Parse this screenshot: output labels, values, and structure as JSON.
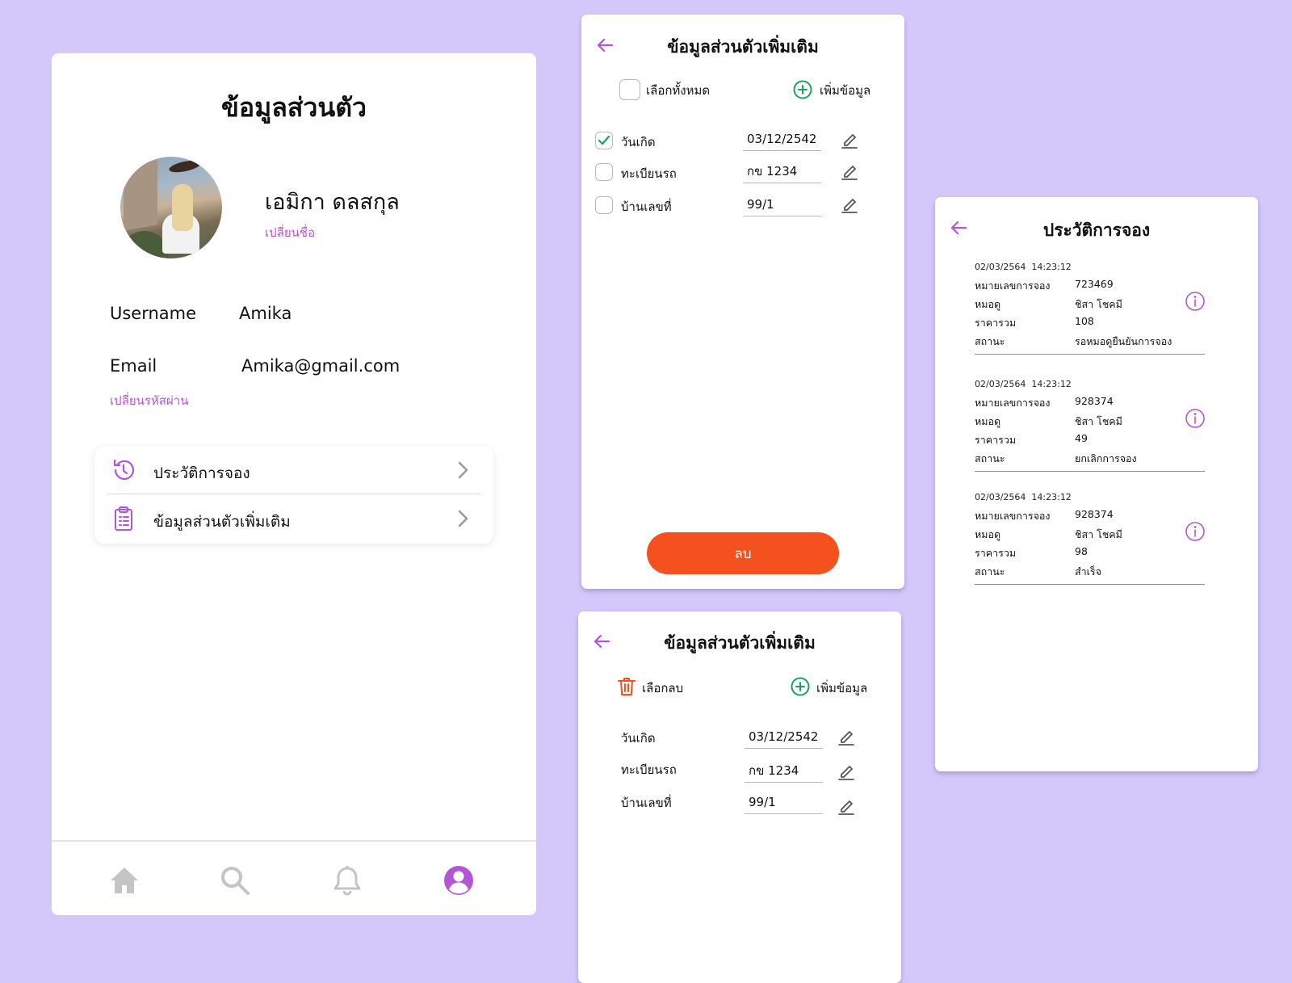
{
  "profile": {
    "title": "ข้อมูลส่วนตัว",
    "name": "เอมิกา ดลสกุล",
    "change_name": "เปลี่ยนชื่อ",
    "username_label": "Username",
    "username_value": "Amika",
    "email_label": "Email",
    "email_value": "Amika@gmail.com",
    "change_password": "เปลี่ยนรหัสผ่าน",
    "menu": [
      {
        "label": "ประวัติการจอง",
        "icon": "history-icon"
      },
      {
        "label": "ข้อมูลส่วนตัวเพิ่มเติม",
        "icon": "clipboard-icon"
      }
    ],
    "nav": [
      {
        "icon": "home-icon",
        "active": false
      },
      {
        "icon": "search-icon",
        "active": false
      },
      {
        "icon": "bell-icon",
        "active": false
      },
      {
        "icon": "profile-icon",
        "active": true
      }
    ]
  },
  "extra_select": {
    "title": "ข้อมูลส่วนตัวเพิ่มเติม",
    "select_all": "เลือกทั้งหมด",
    "add": "เพิ่มข้อมูล",
    "rows": [
      {
        "label": "วันเกิด",
        "value": "03/12/2542",
        "checked": true
      },
      {
        "label": "ทะเบียนรถ",
        "value": "กข 1234",
        "checked": false
      },
      {
        "label": "บ้านเลขที่",
        "value": "99/1",
        "checked": false
      }
    ],
    "delete_button": "ลบ"
  },
  "extra_view": {
    "title": "ข้อมูลส่วนตัวเพิ่มเติม",
    "select_delete": "เลือกลบ",
    "add": "เพิ่มข้อมูล",
    "rows": [
      {
        "label": "วันเกิด",
        "value": "03/12/2542"
      },
      {
        "label": "ทะเบียนรถ",
        "value": "กข 1234"
      },
      {
        "label": "บ้านเลขที่",
        "value": "99/1"
      }
    ]
  },
  "history": {
    "title": "ประวัติการจอง",
    "field_labels": {
      "booking_no": "หมายเลขการจอง",
      "doctor": "หมอดู",
      "total": "ราคารวม",
      "status": "สถานะ"
    },
    "items": [
      {
        "date": "02/03/2564",
        "time": "14:23:12",
        "booking_no": "723469",
        "doctor": "ชิสา โชคมี",
        "total": "108",
        "status": "รอหมอดูยืนยันการจอง"
      },
      {
        "date": "02/03/2564",
        "time": "14:23:12",
        "booking_no": "928374",
        "doctor": "ชิสา โชคมี",
        "total": "49",
        "status": "ยกเลิกการจอง"
      },
      {
        "date": "02/03/2564",
        "time": "14:23:12",
        "booking_no": "928374",
        "doctor": "ชิสา โชคมี",
        "total": "98",
        "status": "สำเร็จ"
      }
    ]
  },
  "colors": {
    "background": "#d4c8fb",
    "accent": "#b455d6",
    "delete": "#f4511e",
    "add": "#1aa35a",
    "nav_inactive": "#c4c4c4"
  }
}
